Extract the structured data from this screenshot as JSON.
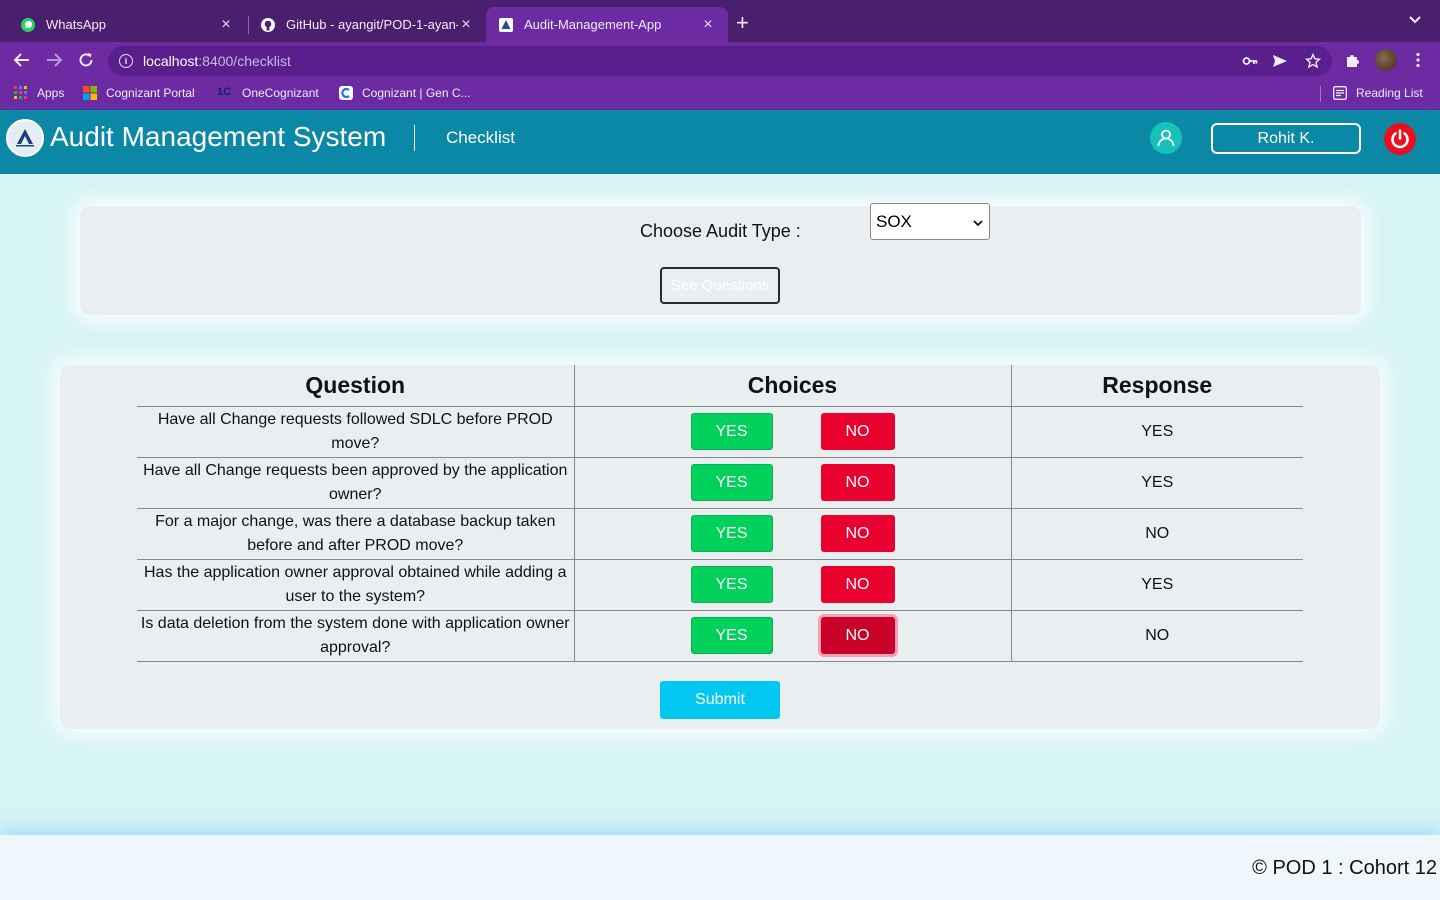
{
  "browser": {
    "tabs": [
      {
        "title": "WhatsApp",
        "icon": "whatsapp-icon"
      },
      {
        "title": "GitHub - ayangit/POD-1-ayan-",
        "icon": "github-icon"
      },
      {
        "title": "Audit-Management-App",
        "icon": "app-favicon",
        "active": true
      }
    ],
    "url_host": "localhost",
    "url_path": ":8400/checklist",
    "bookmarks": [
      {
        "label": "Apps",
        "icon": "apps-grid-icon"
      },
      {
        "label": "Cognizant Portal",
        "icon": "windows-logo-icon"
      },
      {
        "label": "OneCognizant",
        "icon": "onecognizant-icon"
      },
      {
        "label": "Cognizant | Gen C...",
        "icon": "cognizant-icon"
      }
    ],
    "reading_list": "Reading List"
  },
  "header": {
    "title": "Audit Management System",
    "nav_checklist": "Checklist",
    "user_name": "Rohit K.",
    "accent": "#0b88a5"
  },
  "audit": {
    "label": "Choose Audit Type :",
    "selected": "SOX",
    "see_questions": "See Questions"
  },
  "table": {
    "headers": {
      "question": "Question",
      "choices": "Choices",
      "response": "Response"
    },
    "yes_label": "YES",
    "no_label": "NO",
    "rows": [
      {
        "question": "Have all Change requests followed SDLC before PROD move?",
        "response": "YES"
      },
      {
        "question": "Have all Change requests been approved by the application owner?",
        "response": "YES"
      },
      {
        "question": "For a major change, was there a database backup taken before and after PROD move?",
        "response": "NO"
      },
      {
        "question": "Has the application owner approval obtained while adding a user to the system?",
        "response": "YES"
      },
      {
        "question": "Is data deletion from the system done with application owner approval?",
        "response": "NO"
      }
    ]
  },
  "submit_label": "Submit",
  "footer": {
    "text": "© POD 1 : Cohort 12"
  }
}
